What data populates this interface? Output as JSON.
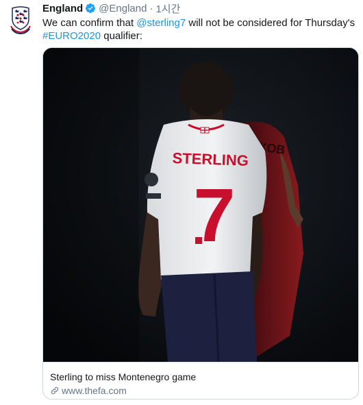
{
  "tweet": {
    "name": "England",
    "handle": "@England",
    "separator": "·",
    "time": "1시간",
    "text": {
      "part1": "We can confirm that ",
      "mention": "@sterling7",
      "part2": " will not be considered for Thursday's ",
      "hashtag": "#EURO2020",
      "part3": " qualifier:"
    }
  },
  "card": {
    "image": {
      "jersey_name": "STERLING",
      "jersey_number": "7",
      "back_player_text": "ЯКОВ"
    },
    "title": "Sterling to miss Montenegro game",
    "url": "www.thefa.com"
  },
  "colors": {
    "link": "#1b95e0",
    "secondary": "#657786",
    "verified": "#1da1f2",
    "primary_text": "#14171a",
    "jersey_red": "#c8102e"
  },
  "icons": {
    "verified": "verified-badge-icon",
    "link": "link-icon",
    "avatar": "england-crest-icon"
  }
}
